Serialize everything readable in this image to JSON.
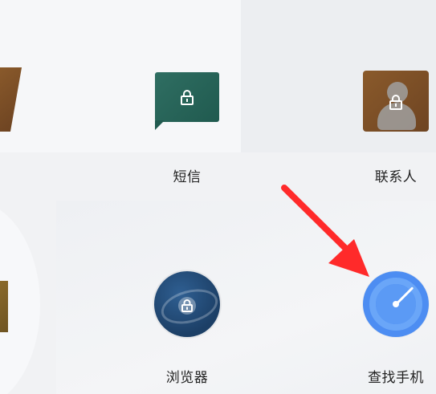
{
  "apps": [
    {
      "id": "sms",
      "label": "短信",
      "icon": "message-lock-icon",
      "color": "#2a6558"
    },
    {
      "id": "contacts",
      "label": "联系人",
      "icon": "contacts-lock-icon",
      "color": "#7b4e27"
    },
    {
      "id": "browser",
      "label": "浏览器",
      "icon": "browser-lock-icon",
      "color": "#21466f"
    },
    {
      "id": "findphone",
      "label": "查找手机",
      "icon": "compass-icon",
      "color": "#4d8df2"
    }
  ],
  "overlay": {
    "arrow_color": "#ff2a2a",
    "arrow_target": "findphone"
  }
}
